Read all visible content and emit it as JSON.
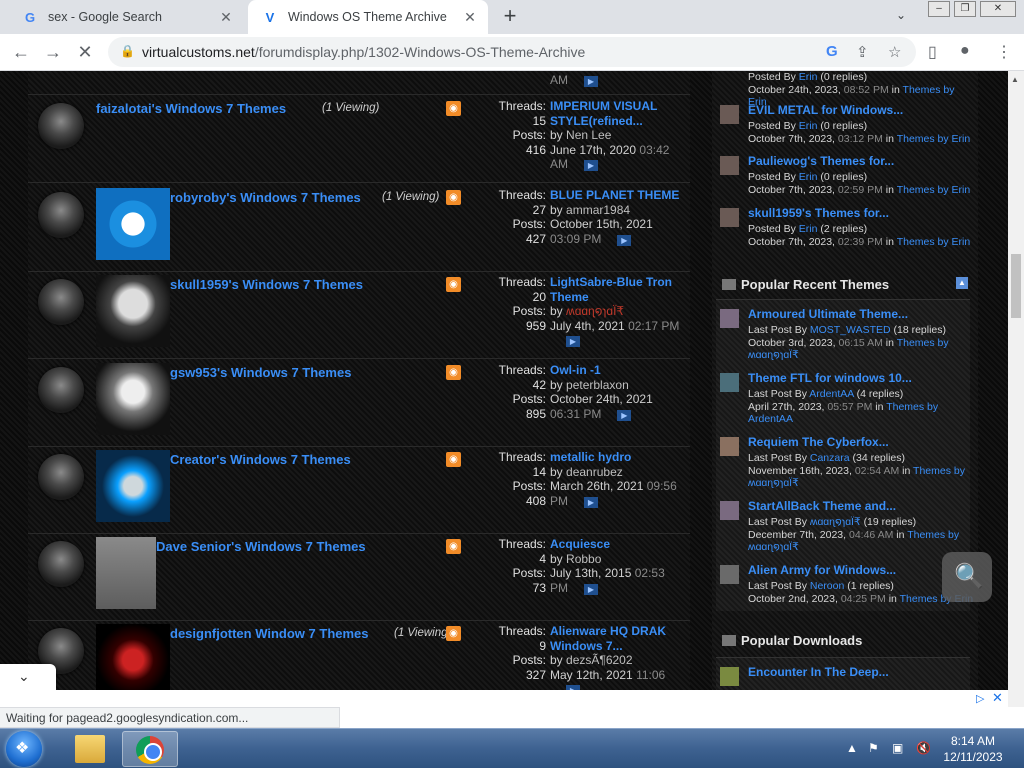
{
  "browser": {
    "tabs": [
      {
        "title": "sex - Google Search",
        "favicon": "G"
      },
      {
        "title": "Windows OS Theme Archive",
        "favicon": "V"
      }
    ],
    "url_host": "virtualcustoms.net",
    "url_path": "/forumdisplay.php/1302-Windows-OS-Theme-Archive",
    "status": "Waiting for pagead2.googlesyndication.com..."
  },
  "top_partial": {
    "time_tail": "AM"
  },
  "forums": [
    {
      "name": "faizalotai's Windows 7 Themes",
      "viewing": "(1 Viewing)",
      "threads_label": "Threads:",
      "threads": "15",
      "posts_label": "Posts:",
      "posts": "416",
      "last_title": "IMPERIUM VISUAL STYLE(refined...",
      "by": "by",
      "user": "Nen Lee",
      "date": "June 17th, 2020",
      "time": "03:42 AM"
    },
    {
      "name": "robyroby's Windows 7 Themes",
      "viewing": "(1 Viewing)",
      "threads_label": "Threads:",
      "threads": "27",
      "posts_label": "Posts:",
      "posts": "427",
      "last_title": "BLUE PLANET THEME",
      "by": "by",
      "user": "ammar1984",
      "date": "October 15th, 2021",
      "time": "03:09 PM"
    },
    {
      "name": "skull1959's Windows 7 Themes",
      "viewing": "",
      "threads_label": "Threads:",
      "threads": "20",
      "posts_label": "Posts:",
      "posts": "959",
      "last_title": "LightSabre-Blue Tron Theme",
      "by": "by",
      "user": "ʍɑɑɳ໑ɿɑÏ₹",
      "date": "July 4th, 2021",
      "time": "02:17 PM"
    },
    {
      "name": "gsw953's Windows 7 Themes",
      "viewing": "",
      "threads_label": "Threads:",
      "threads": "42",
      "posts_label": "Posts:",
      "posts": "895",
      "last_title": "Owl-in -1",
      "by": "by",
      "user": "peterblaxon",
      "date": "October 24th, 2021",
      "time": "06:31 PM"
    },
    {
      "name": "Creator's Windows 7 Themes",
      "viewing": "",
      "threads_label": "Threads:",
      "threads": "14",
      "posts_label": "Posts:",
      "posts": "408",
      "last_title": "metallic hydro",
      "by": "by",
      "user": "deanrubez",
      "date": "March 26th, 2021",
      "time": "09:56 PM"
    },
    {
      "name": "Dave Senior's Windows 7 Themes",
      "viewing": "",
      "threads_label": "Threads:",
      "threads": "4",
      "posts_label": "Posts:",
      "posts": "73",
      "last_title": "Acquiesce",
      "by": "by",
      "user": "Robbo",
      "date": "July 13th, 2015",
      "time": "02:53 PM"
    },
    {
      "name": "designfjotten Window 7 Themes",
      "viewing": "(1 Viewing)",
      "threads_label": "Threads:",
      "threads": "9",
      "posts_label": "Posts:",
      "posts": "327",
      "last_title": "Alienware HQ DRAK Windows 7...",
      "by": "by",
      "user": "dezsÃ¶6202",
      "date": "May 12th, 2021",
      "time": "11:06"
    }
  ],
  "sidebar": {
    "top_items": [
      {
        "title": "",
        "meta1_pre": "Posted By",
        "user": "Erin",
        "meta1_post": "(0 replies)",
        "date": "October 24th, 2023,",
        "time": "08:52 PM",
        "in": "in",
        "forum": "Themes by Erin"
      },
      {
        "title": "EVIL METAL for Windows...",
        "meta1_pre": "Posted By",
        "user": "Erin",
        "meta1_post": "(0 replies)",
        "date": "October 7th, 2023,",
        "time": "03:12 PM",
        "in": "in",
        "forum": "Themes by Erin"
      },
      {
        "title": "Pauliewog's Themes for...",
        "meta1_pre": "Posted By",
        "user": "Erin",
        "meta1_post": "(0 replies)",
        "date": "October 7th, 2023,",
        "time": "02:59 PM",
        "in": "in",
        "forum": "Themes by Erin"
      },
      {
        "title": "skull1959's Themes for...",
        "meta1_pre": "Posted By",
        "user": "Erin",
        "meta1_post": "(2 replies)",
        "date": "October 7th, 2023,",
        "time": "02:39 PM",
        "in": "in",
        "forum": "Themes by Erin"
      }
    ],
    "popular_recent_title": "Popular Recent Themes",
    "popular_recent": [
      {
        "title": "Armoured Ultimate Theme...",
        "pre": "Last Post By",
        "user": "MOST_WASTED",
        "replies": "(18 replies)",
        "date": "October 3rd, 2023,",
        "time": "06:15 AM",
        "in": "in",
        "forum": "Themes by ʍɑɑɳ໑ɿɑÏ₹"
      },
      {
        "title": "Theme FTL for windows 10...",
        "pre": "Last Post By",
        "user": "ArdentAA",
        "replies": "(4 replies)",
        "date": "April 27th, 2023,",
        "time": "05:57 PM",
        "in": "in",
        "forum": "Themes by ArdentAA"
      },
      {
        "title": "Requiem The Cyberfox...",
        "pre": "Last Post By",
        "user": "Canzara",
        "replies": "(34 replies)",
        "date": "November 16th, 2023,",
        "time": "02:54 AM",
        "in": "in",
        "forum": "Themes by ʍɑɑɳ໑ɿɑÏ₹"
      },
      {
        "title": "StartAllBack Theme and...",
        "pre": "Last Post By",
        "user": "ʍɑɑɳ໑ɿɑÏ₹",
        "replies": "(19 replies)",
        "date": "December 7th, 2023,",
        "time": "04:46 AM",
        "in": "in",
        "forum": "Themes by ʍɑɑɳ໑ɿɑÏ₹"
      },
      {
        "title": "Alien Army for Windows...",
        "pre": "Last Post By",
        "user": "Neroon",
        "replies": "(1 replies)",
        "date": "October 2nd, 2023,",
        "time": "04:25 PM",
        "in": "in",
        "forum": "Themes by Erin"
      }
    ],
    "popular_downloads_title": "Popular Downloads",
    "downloads": [
      {
        "title": "Encounter In The Deep..."
      }
    ]
  },
  "taskbar": {
    "time": "8:14 AM",
    "date": "12/11/2023"
  }
}
